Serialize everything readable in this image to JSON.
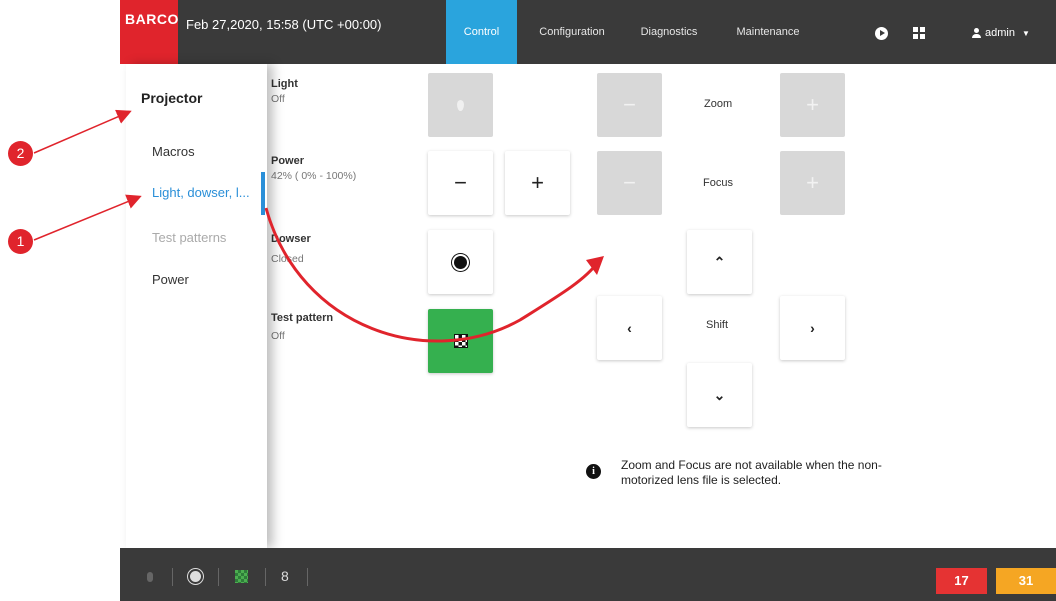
{
  "header": {
    "brand": "BARCO",
    "datetime": "Feb 27,2020, 15:58 (UTC +00:00)",
    "tabs": [
      {
        "label": "Control",
        "active": true
      },
      {
        "label": "Configuration",
        "active": false
      },
      {
        "label": "Diagnostics",
        "active": false
      },
      {
        "label": "Maintenance",
        "active": false
      }
    ],
    "user": "admin",
    "icons": [
      "play-icon",
      "grid-icon",
      "user-icon",
      "caret-down-icon"
    ],
    "accent_color": "#2aa4dd",
    "brand_color": "#e0242c"
  },
  "sidebar": {
    "title": "Projector",
    "items": [
      {
        "label": "Macros",
        "state": "normal"
      },
      {
        "label": "Light, dowser, l...",
        "state": "active"
      },
      {
        "label": "Test patterns",
        "state": "disabled"
      },
      {
        "label": "Power",
        "state": "normal"
      }
    ]
  },
  "controls": {
    "light": {
      "label": "Light",
      "value": "Off"
    },
    "power": {
      "label": "Power",
      "value": "42% ( 0% - 100%)",
      "minus": "−",
      "plus": "+"
    },
    "dowser": {
      "label": "Dowser",
      "value": "Closed"
    },
    "test_pattern": {
      "label": "Test pattern",
      "value": "Off"
    }
  },
  "lens": {
    "zoom_label": "Zoom",
    "focus_label": "Focus",
    "shift_label": "Shift",
    "minus": "−",
    "plus": "+",
    "up": "⌃",
    "down": "⌄",
    "left": "‹",
    "right": "›"
  },
  "info": {
    "text": "Zoom and Focus are not available when the non-motorized lens file is selected."
  },
  "footer": {
    "error_count": "17",
    "warning_count": "31",
    "error_color": "#e53333",
    "warning_color": "#f5a623"
  },
  "annotations": {
    "marker_1": "1",
    "marker_2": "2",
    "color": "#e0242c"
  }
}
